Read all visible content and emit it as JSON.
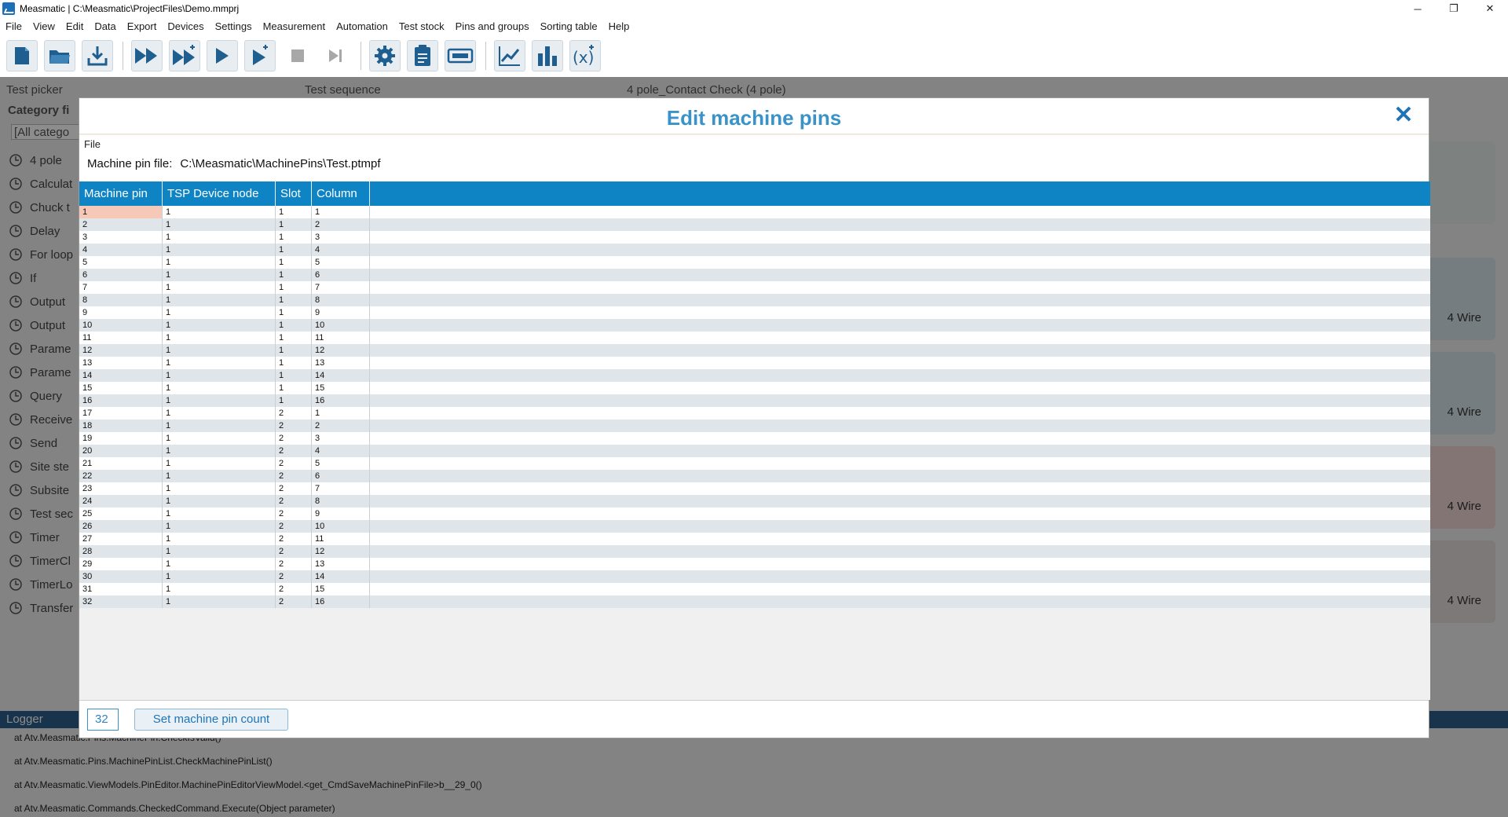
{
  "window": {
    "title": "Measmatic | C:\\Measmatic\\ProjectFiles\\Demo.mmprj",
    "minimize": "─",
    "maximize": "❐",
    "close": "✕"
  },
  "menu": [
    "File",
    "View",
    "Edit",
    "Data",
    "Export",
    "Devices",
    "Settings",
    "Measurement",
    "Automation",
    "Test stock",
    "Pins and groups",
    "Sorting table",
    "Help"
  ],
  "toolbar": {
    "icons": [
      "new-file-icon",
      "open-folder-icon",
      "download-icon",
      "run-all-icon",
      "run-all-plus-icon",
      "play-icon",
      "play-plus-icon",
      "stop-icon",
      "step-icon",
      "settings-gear-icon",
      "clipboard-icon",
      "device-icon",
      "line-chart-icon",
      "bar-chart-icon",
      "function-icon"
    ]
  },
  "background": {
    "test_picker": "Test picker",
    "test_sequence": "Test sequence",
    "sequence_name": "4 pole_Contact Check (4 pole)",
    "category_label": "Category fi",
    "category_value": "[All catego",
    "sidebar_items": [
      "4 pole",
      "Calculat",
      "Chuck t",
      "Delay",
      "For loop",
      "If",
      "Output",
      "Output",
      "Parame",
      "Parame",
      "Query",
      "Receive",
      "Send",
      "Site ste",
      "Subsite",
      "Test sec",
      "Timer",
      "TimerCl",
      "TimerLo",
      "Transfer"
    ],
    "card_labels": [
      "4 Wire",
      "4 Wire",
      "4 Wire",
      "4 Wire"
    ],
    "logger_title": "Logger",
    "logger_lines": [
      "at Atv.Measmatic.Pins.MachinePin.CheckIsValid()",
      "at Atv.Measmatic.Pins.MachinePinList.CheckMachinePinList()",
      "at Atv.Measmatic.ViewModels.PinEditor.MachinePinEditorViewModel.<get_CmdSaveMachinePinFile>b__29_0()",
      "at Atv.Measmatic.Commands.CheckedCommand.Execute(Object parameter)"
    ]
  },
  "dialog": {
    "title": "Edit machine pins",
    "file_menu": "File",
    "pin_file_label": "Machine pin file:",
    "pin_file_path": "C:\\Measmatic\\MachinePins\\Test.ptmpf",
    "columns": [
      "Machine pin",
      "TSP Device node",
      "Slot",
      "Column"
    ],
    "rows": [
      [
        "1",
        "1",
        "1",
        "1"
      ],
      [
        "2",
        "1",
        "1",
        "2"
      ],
      [
        "3",
        "1",
        "1",
        "3"
      ],
      [
        "4",
        "1",
        "1",
        "4"
      ],
      [
        "5",
        "1",
        "1",
        "5"
      ],
      [
        "6",
        "1",
        "1",
        "6"
      ],
      [
        "7",
        "1",
        "1",
        "7"
      ],
      [
        "8",
        "1",
        "1",
        "8"
      ],
      [
        "9",
        "1",
        "1",
        "9"
      ],
      [
        "10",
        "1",
        "1",
        "10"
      ],
      [
        "11",
        "1",
        "1",
        "11"
      ],
      [
        "12",
        "1",
        "1",
        "12"
      ],
      [
        "13",
        "1",
        "1",
        "13"
      ],
      [
        "14",
        "1",
        "1",
        "14"
      ],
      [
        "15",
        "1",
        "1",
        "15"
      ],
      [
        "16",
        "1",
        "1",
        "16"
      ],
      [
        "17",
        "1",
        "2",
        "1"
      ],
      [
        "18",
        "1",
        "2",
        "2"
      ],
      [
        "19",
        "1",
        "2",
        "3"
      ],
      [
        "20",
        "1",
        "2",
        "4"
      ],
      [
        "21",
        "1",
        "2",
        "5"
      ],
      [
        "22",
        "1",
        "2",
        "6"
      ],
      [
        "23",
        "1",
        "2",
        "7"
      ],
      [
        "24",
        "1",
        "2",
        "8"
      ],
      [
        "25",
        "1",
        "2",
        "9"
      ],
      [
        "26",
        "1",
        "2",
        "10"
      ],
      [
        "27",
        "1",
        "2",
        "11"
      ],
      [
        "28",
        "1",
        "2",
        "12"
      ],
      [
        "29",
        "1",
        "2",
        "13"
      ],
      [
        "30",
        "1",
        "2",
        "14"
      ],
      [
        "31",
        "1",
        "2",
        "15"
      ],
      [
        "32",
        "1",
        "2",
        "16"
      ]
    ],
    "pin_count_value": "32",
    "set_button": "Set machine pin count",
    "close_icon": "✕"
  },
  "colors": {
    "accent": "#3a93c8",
    "grid_header": "#0f84c5",
    "selected_cell": "#f6c8b8",
    "logger_bar": "#2d5f8a"
  }
}
